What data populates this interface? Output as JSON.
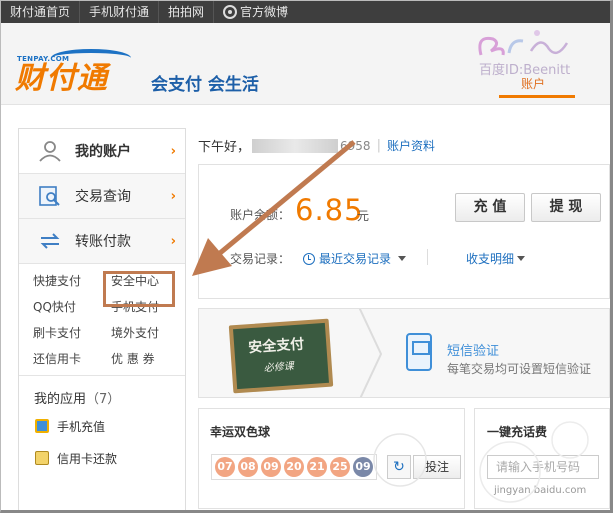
{
  "topnav": {
    "items": [
      "财付通首页",
      "手机财付通",
      "拍拍网",
      "官方微博"
    ]
  },
  "header": {
    "logo_en": "TENPAY.COM",
    "logo_cn": "财付通",
    "slogan": "会支付 会生活",
    "watermark": "百度ID:Beenitt",
    "tab_label": "账户"
  },
  "sidebar": {
    "nav": [
      {
        "label": "我的账户",
        "icon": "user-icon"
      },
      {
        "label": "交易查询",
        "icon": "search-document-icon"
      },
      {
        "label": "转账付款",
        "icon": "transfer-arrows-icon"
      }
    ],
    "quick_links": [
      "快捷支付",
      "安全中心",
      "QQ快付",
      "手机支付",
      "刷卡支付",
      "境外支付",
      "还信用卡",
      "优 惠 券"
    ],
    "apps_title": "我的应用",
    "apps_count": "（7）",
    "apps": [
      {
        "label": "手机充值",
        "icon": "mobile-recharge-icon"
      },
      {
        "label": "信用卡还款",
        "icon": "credit-card-icon"
      }
    ]
  },
  "main": {
    "greeting": "下午好，",
    "account_tail": "6958",
    "account_link": "账户资料",
    "balance_label": "账户余额：",
    "balance_value": "6.85",
    "balance_unit": "元",
    "recharge_button": "充 值",
    "withdraw_button": "提 现",
    "trade_label": "交易记录：",
    "recent_trades": "最近交易记录",
    "income_detail": "收支明细"
  },
  "promo": {
    "chalk_title": "安全支付",
    "chalk_sub": "必修课",
    "sms_title": "短信验证",
    "sms_desc": "每笔交易均可设置短信验证"
  },
  "lottery": {
    "title": "幸运双色球",
    "red_balls": [
      "07",
      "08",
      "09",
      "20",
      "21",
      "25"
    ],
    "blue_ball": "09",
    "bet_button": "投注"
  },
  "topup": {
    "title": "一键充话费",
    "placeholder": "请输入手机号码"
  },
  "footer_watermark": "jingyan.baidu.com",
  "colors": {
    "brand_orange": "#f07a00",
    "link_blue": "#1d6fbf",
    "highlight_brown": "#c07a50"
  }
}
